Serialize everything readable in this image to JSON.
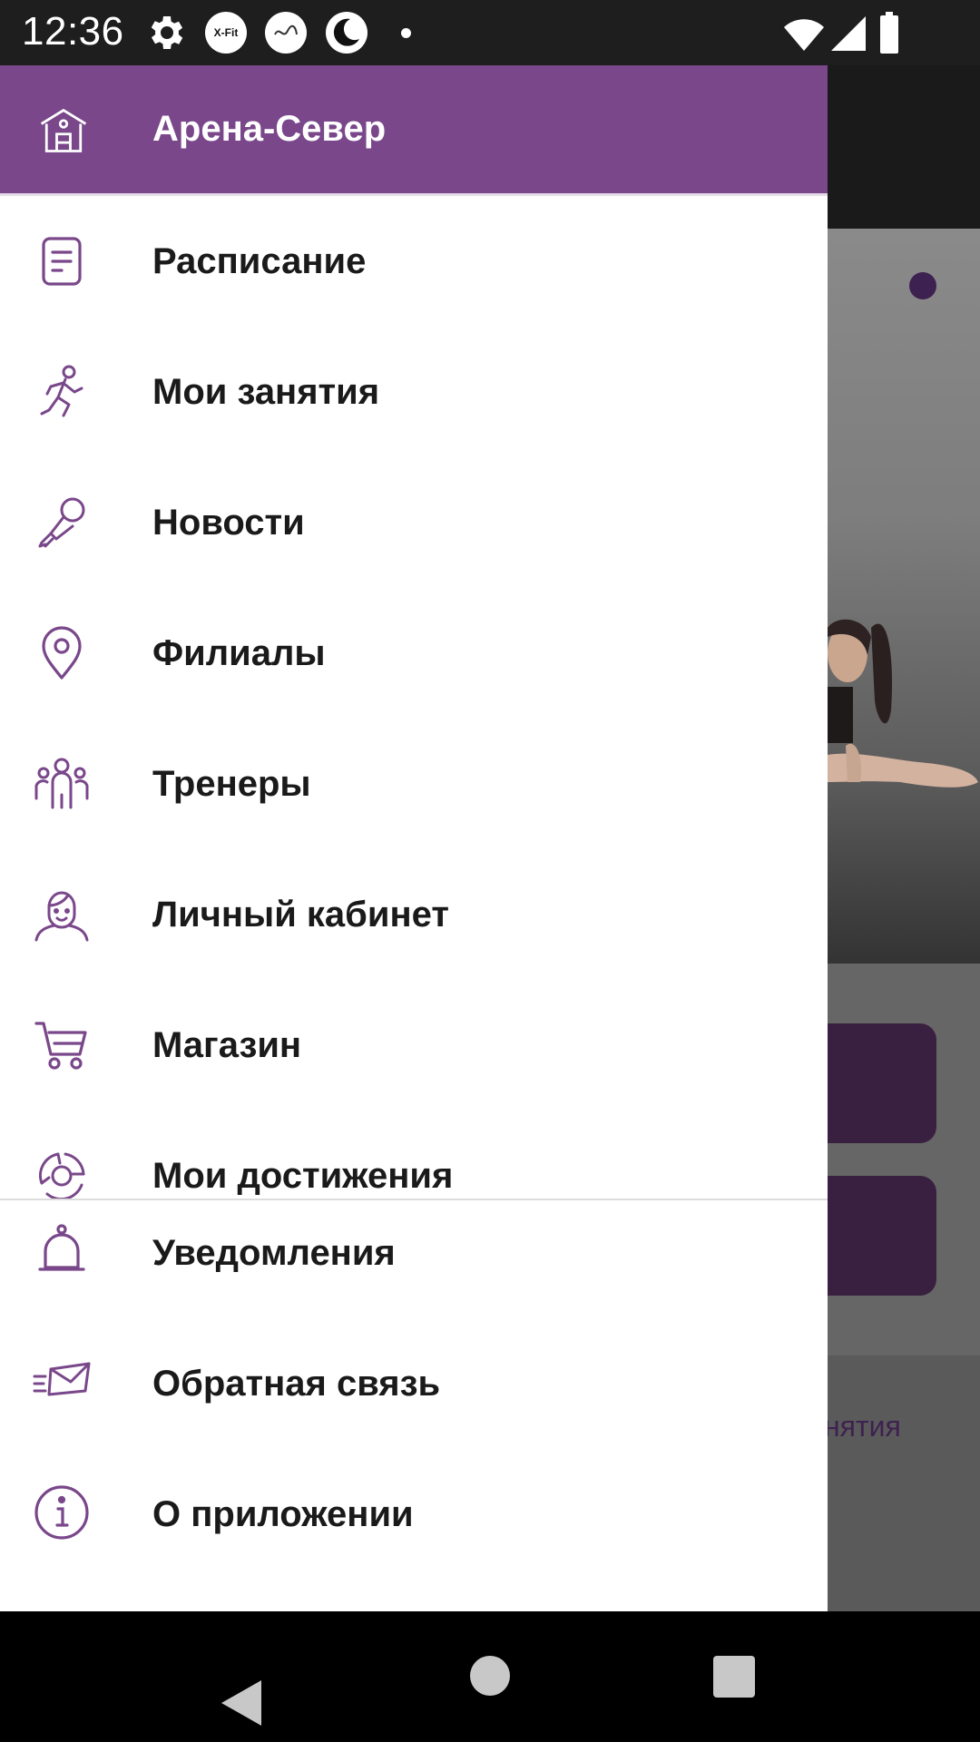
{
  "status_bar": {
    "time": "12:36",
    "icons": [
      "gear-icon",
      "xfit-app-icon",
      "app-logo-icon",
      "moon-icon",
      "dot-icon",
      "wifi-icon",
      "signal-icon",
      "battery-icon"
    ],
    "xfit_label": "X-Fit"
  },
  "drawer": {
    "header_title": "Арена-Север",
    "header_color": "#79478a",
    "items": [
      {
        "label": "Расписание",
        "icon": "schedule-icon"
      },
      {
        "label": "Мои занятия",
        "icon": "running-person-icon"
      },
      {
        "label": "Новости",
        "icon": "microphone-icon"
      },
      {
        "label": "Филиалы",
        "icon": "location-pin-icon"
      },
      {
        "label": "Тренеры",
        "icon": "group-icon"
      },
      {
        "label": "Личный кабинет",
        "icon": "person-icon"
      },
      {
        "label": "Магазин",
        "icon": "cart-icon"
      },
      {
        "label": "Мои достижения",
        "icon": "achievements-icon"
      }
    ],
    "bottom_items": [
      {
        "label": "Уведомления",
        "icon": "bell-icon"
      },
      {
        "label": "Обратная связь",
        "icon": "mail-icon"
      },
      {
        "label": "О приложении",
        "icon": "info-icon"
      }
    ]
  },
  "background": {
    "partial_tab_label": "нятия"
  },
  "accent_color": "#79478a"
}
